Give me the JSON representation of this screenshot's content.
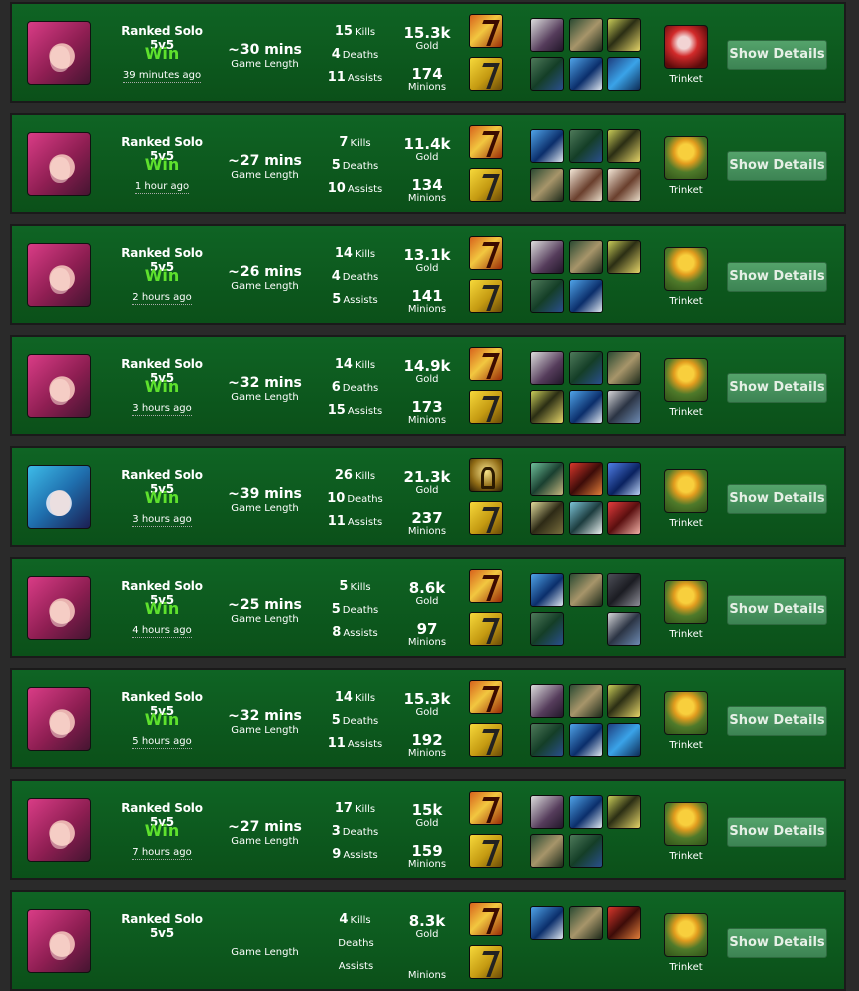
{
  "labels": {
    "kills": "Kills",
    "deaths": "Deaths",
    "assists": "Assists",
    "gold": "Gold",
    "minions": "Minions",
    "game_length": "Game Length",
    "trinket": "Trinket",
    "show_details": "Show Details"
  },
  "matches": [
    {
      "champion": "vi",
      "queue": "Ranked Solo 5v5",
      "result": "Win",
      "ago": "39 minutes ago",
      "length": "~30 mins",
      "kills": "15",
      "deaths": "4",
      "assists": "11",
      "gold": "15.3k",
      "minions": "174",
      "spells": [
        "ignite",
        "flash"
      ],
      "items": [
        "it-a",
        "it-b",
        "it-c",
        "it-d",
        "it-e",
        "it-f"
      ],
      "trinket": "sweeper"
    },
    {
      "champion": "vi",
      "queue": "Ranked Solo 5v5",
      "result": "Win",
      "ago": "1 hour ago",
      "length": "~27 mins",
      "kills": "7",
      "deaths": "5",
      "assists": "10",
      "gold": "11.4k",
      "minions": "134",
      "spells": [
        "ignite",
        "flash"
      ],
      "items": [
        "it-e",
        "it-d",
        "it-c",
        "it-b",
        "it-g",
        "it-g"
      ],
      "trinket": "ward"
    },
    {
      "champion": "vi",
      "queue": "Ranked Solo 5v5",
      "result": "Win",
      "ago": "2 hours ago",
      "length": "~26 mins",
      "kills": "14",
      "deaths": "4",
      "assists": "5",
      "gold": "13.1k",
      "minions": "141",
      "spells": [
        "ignite",
        "flash"
      ],
      "items": [
        "it-a",
        "it-b",
        "it-c",
        "it-d",
        "it-e",
        ""
      ],
      "trinket": "ward"
    },
    {
      "champion": "vi",
      "queue": "Ranked Solo 5v5",
      "result": "Win",
      "ago": "3 hours ago",
      "length": "~32 mins",
      "kills": "14",
      "deaths": "6",
      "assists": "15",
      "gold": "14.9k",
      "minions": "173",
      "spells": [
        "ignite",
        "flash"
      ],
      "items": [
        "it-a",
        "it-d",
        "it-b",
        "it-c",
        "it-e",
        "it-h"
      ],
      "trinket": "ward"
    },
    {
      "champion": "jinx",
      "queue": "Ranked Solo 5v5",
      "result": "Win",
      "ago": "3 hours ago",
      "length": "~39 mins",
      "kills": "26",
      "deaths": "10",
      "assists": "11",
      "gold": "21.3k",
      "minions": "237",
      "spells": [
        "ghost",
        "flash"
      ],
      "items": [
        "it-i",
        "it-j",
        "it-k",
        "it-l",
        "it-m",
        "it-n"
      ],
      "trinket": "ward"
    },
    {
      "champion": "vi",
      "queue": "Ranked Solo 5v5",
      "result": "Win",
      "ago": "4 hours ago",
      "length": "~25 mins",
      "kills": "5",
      "deaths": "5",
      "assists": "8",
      "gold": "8.6k",
      "minions": "97",
      "spells": [
        "ignite",
        "flash"
      ],
      "items": [
        "it-e",
        "it-b",
        "it-o",
        "it-d",
        "",
        "it-h"
      ],
      "trinket": "ward"
    },
    {
      "champion": "vi",
      "queue": "Ranked Solo 5v5",
      "result": "Win",
      "ago": "5 hours ago",
      "length": "~32 mins",
      "kills": "14",
      "deaths": "5",
      "assists": "11",
      "gold": "15.3k",
      "minions": "192",
      "spells": [
        "ignite",
        "flash"
      ],
      "items": [
        "it-a",
        "it-b",
        "it-c",
        "it-d",
        "it-e",
        "it-f"
      ],
      "trinket": "ward"
    },
    {
      "champion": "vi",
      "queue": "Ranked Solo 5v5",
      "result": "Win",
      "ago": "7 hours ago",
      "length": "~27 mins",
      "kills": "17",
      "deaths": "3",
      "assists": "9",
      "gold": "15k",
      "minions": "159",
      "spells": [
        "ignite",
        "flash"
      ],
      "items": [
        "it-a",
        "it-e",
        "it-c",
        "it-b",
        "it-d",
        ""
      ],
      "trinket": "ward"
    },
    {
      "champion": "vi",
      "queue": "Ranked Solo 5v5",
      "result": "",
      "ago": "",
      "length": "",
      "kills": "4",
      "deaths": "",
      "assists": "",
      "gold": "8.3k",
      "minions": "",
      "spells": [
        "ignite",
        "flash"
      ],
      "items": [
        "it-e",
        "it-b",
        "it-j",
        "",
        "",
        ""
      ],
      "trinket": "ward"
    }
  ]
}
